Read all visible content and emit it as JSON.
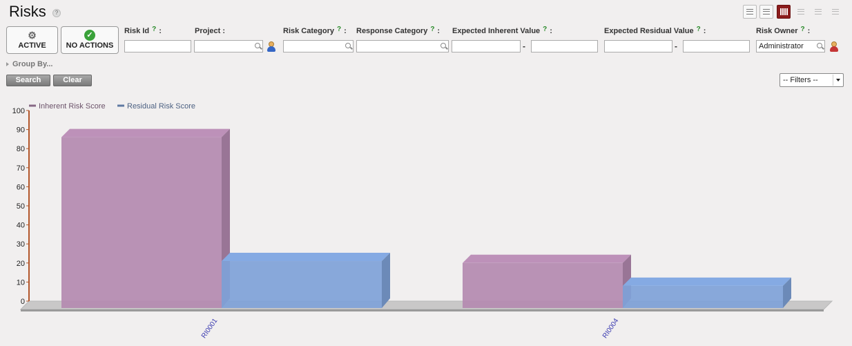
{
  "page": {
    "title": "Risks",
    "help": "?"
  },
  "state_buttons": {
    "active": "ACTIVE",
    "no_actions": "NO ACTIONS"
  },
  "filters": {
    "risk_id": "Risk Id",
    "project": "Project :",
    "risk_category": "Risk Category",
    "response_category": "Response Category",
    "expected_inherent_value": "Expected Inherent Value",
    "expected_residual_value": "Expected Residual Value",
    "risk_owner": "Risk Owner",
    "risk_owner_value": "Administrator",
    "help_mark": "?",
    "colon": ":",
    "range_dash": "-"
  },
  "group_by": "Group By...",
  "buttons": {
    "search": "Search",
    "clear": "Clear"
  },
  "filters_dropdown": {
    "selected": "-- Filters --"
  },
  "icons": [
    "help-icon",
    "list-view-icon",
    "detail-view-icon",
    "chart-view-icon",
    "calendar-view-icon",
    "gantt-view-icon",
    "grid-view-icon",
    "gears-icon",
    "check-icon",
    "search-icon",
    "person-icon",
    "person-remove-icon"
  ],
  "chart_data": {
    "type": "bar",
    "categories": [
      "RI0001",
      "RI0004"
    ],
    "series": [
      {
        "name": "Inherent Risk Score",
        "values": [
          86,
          20
        ],
        "color": "#b48ab0"
      },
      {
        "name": "Residual Risk Score",
        "values": [
          21,
          8
        ],
        "color": "#7fa2d8"
      }
    ],
    "ylim": [
      0,
      100
    ],
    "yticks": [
      0,
      10,
      20,
      30,
      40,
      50,
      60,
      70,
      80,
      90,
      100
    ],
    "legend_position": "top-left",
    "grid": false
  }
}
